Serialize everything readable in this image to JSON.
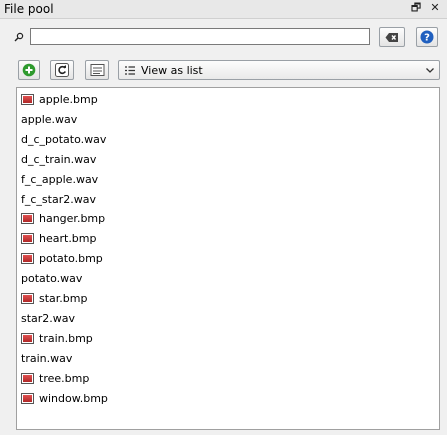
{
  "window": {
    "title": "File pool",
    "restore_glyph": "🗗",
    "close_glyph": "✕"
  },
  "search": {
    "value": "",
    "placeholder": ""
  },
  "toolbar": {
    "view_label": "View as list"
  },
  "files": [
    {
      "name": "apple.bmp",
      "icon": "bmp-icon"
    },
    {
      "name": "apple.wav",
      "icon": ""
    },
    {
      "name": "d_c_potato.wav",
      "icon": ""
    },
    {
      "name": "d_c_train.wav",
      "icon": ""
    },
    {
      "name": "f_c_apple.wav",
      "icon": ""
    },
    {
      "name": "f_c_star2.wav",
      "icon": ""
    },
    {
      "name": "hanger.bmp",
      "icon": "bmp-icon"
    },
    {
      "name": "heart.bmp",
      "icon": "bmp-icon"
    },
    {
      "name": "potato.bmp",
      "icon": "bmp-icon"
    },
    {
      "name": "potato.wav",
      "icon": ""
    },
    {
      "name": "star.bmp",
      "icon": "bmp-icon"
    },
    {
      "name": "star2.wav",
      "icon": ""
    },
    {
      "name": "train.bmp",
      "icon": "bmp-icon"
    },
    {
      "name": "train.wav",
      "icon": ""
    },
    {
      "name": "tree.bmp",
      "icon": "bmp-icon"
    },
    {
      "name": "window.bmp",
      "icon": "bmp-icon"
    }
  ],
  "colors": {
    "accent_green": "#2e9a2e",
    "help_blue": "#1f5fbf",
    "bmp_red": "#c83232"
  }
}
